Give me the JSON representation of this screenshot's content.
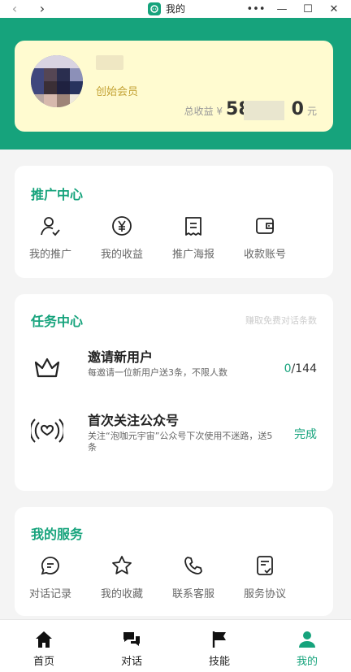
{
  "window": {
    "title": "我的"
  },
  "profile": {
    "member_label": "创始会员",
    "income_label": "总收益 ¥",
    "income_value": "58",
    "income_value_tail": "0",
    "income_unit": "元"
  },
  "promo": {
    "title": "推广中心",
    "items": [
      {
        "label": "我的推广",
        "icon": "user-check-icon"
      },
      {
        "label": "我的收益",
        "icon": "yen-icon"
      },
      {
        "label": "推广海报",
        "icon": "poster-icon"
      },
      {
        "label": "收款账号",
        "icon": "wallet-icon"
      }
    ]
  },
  "tasks": {
    "title": "任务中心",
    "hint": "赚取免费对话条数",
    "items": [
      {
        "name": "邀请新用户",
        "desc": "每邀请一位新用户送3条，不限人数",
        "progress_done": "0",
        "progress_total": "/144",
        "icon": "crown-icon"
      },
      {
        "name": "首次关注公众号",
        "desc": "关注“泡咖元宇宙”公众号下次使用不迷路，送5条",
        "status": "完成",
        "icon": "broadcast-heart-icon"
      }
    ]
  },
  "services": {
    "title": "我的服务",
    "items": [
      {
        "label": "对话记录",
        "icon": "chat-history-icon"
      },
      {
        "label": "我的收藏",
        "icon": "star-icon"
      },
      {
        "label": "联系客服",
        "icon": "phone-icon"
      },
      {
        "label": "服务协议",
        "icon": "document-check-icon"
      }
    ]
  },
  "nav": {
    "items": [
      {
        "label": "首页",
        "icon": "home-icon"
      },
      {
        "label": "对话",
        "icon": "chat-icon"
      },
      {
        "label": "技能",
        "icon": "flag-icon"
      },
      {
        "label": "我的",
        "icon": "profile-icon"
      }
    ],
    "active": "我的"
  },
  "colors": {
    "accent": "#16a37c",
    "gold": "#c4a335",
    "card_bg": "#fffbd0"
  }
}
